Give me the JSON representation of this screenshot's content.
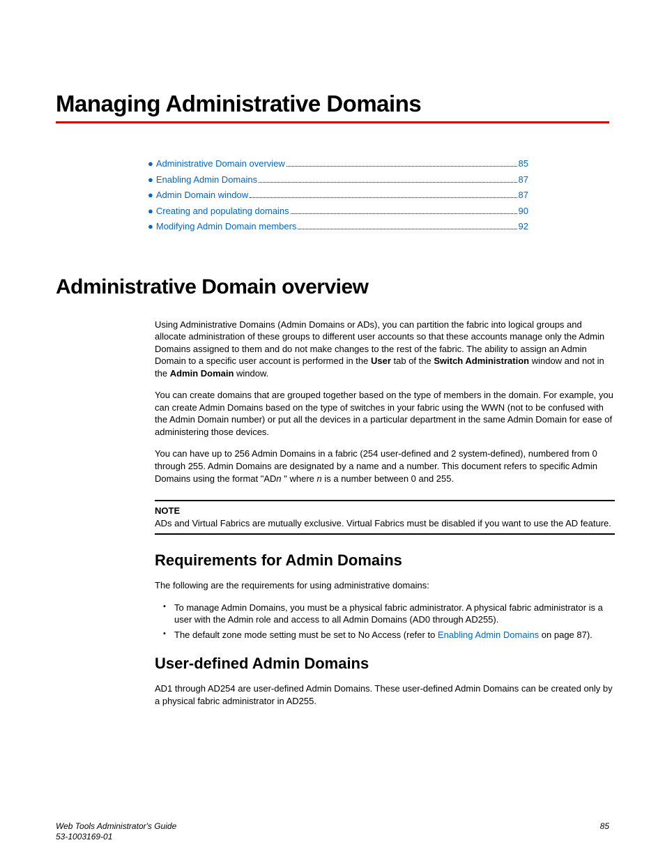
{
  "chapter": {
    "title": "Managing Administrative Domains"
  },
  "toc": {
    "items": [
      {
        "label": "Administrative Domain overview",
        "page": "85"
      },
      {
        "label": "Enabling Admin Domains",
        "page": "87"
      },
      {
        "label": "Admin Domain window",
        "page": "87"
      },
      {
        "label": "Creating and populating domains",
        "page": "90"
      },
      {
        "label": "Modifying Admin Domain members",
        "page": "92"
      }
    ]
  },
  "section1": {
    "title": "Administrative Domain overview",
    "p1a": "Using Administrative Domains (Admin Domains or ADs), you can partition the fabric into logical groups and allocate administration of these groups to different user accounts so that these accounts manage only the Admin Domains assigned to them and do not make changes to the rest of the fabric. The ability to assign an Admin Domain to a specific user account is performed in the ",
    "p1b_bold": "User",
    "p1c": " tab of the ",
    "p1d_bold": "Switch Administration",
    "p1e": " window and not in the ",
    "p1f_bold": "Admin Domain",
    "p1g": " window.",
    "p2": "You can create domains that are grouped together based on the type of members in the domain. For example, you can create Admin Domains based on the type of switches in your fabric using the WWN (not to be confused with the Admin Domain number) or put all the devices in a particular department in the same Admin Domain for ease of administering those devices.",
    "p3a": "You can have up to 256 Admin Domains in a fabric (254 user-defined and 2 system-defined), numbered from 0 through 255. Admin Domains are designated by a name and a number. This document refers to specific Admin Domains using the format \"AD",
    "p3b_it": "n",
    "p3c": " \" where ",
    "p3d_it": "n",
    "p3e": " is a number between 0 and 255."
  },
  "note": {
    "label": "NOTE",
    "text": "ADs and Virtual Fabrics are mutually exclusive. Virtual Fabrics must be disabled if you want to use the AD feature."
  },
  "subsection1": {
    "title": "Requirements for Admin Domains",
    "intro": "The following are the requirements for using administrative domains:",
    "b1": "To manage Admin Domains, you must be a physical fabric administrator. A physical fabric administrator is a user with the Admin role and access to all Admin Domains (AD0 through AD255).",
    "b2a": "The default zone mode setting must be set to No Access (refer to ",
    "b2link": "Enabling Admin Domains",
    "b2b": " on page 87)."
  },
  "subsection2": {
    "title": "User-defined Admin Domains",
    "p1": "AD1 through AD254 are user-defined Admin Domains. These user-defined Admin Domains can be created only by a physical fabric administrator in AD255."
  },
  "footer": {
    "guide": "Web Tools Administrator's Guide",
    "docnum": "53-1003169-01",
    "page": "85"
  }
}
